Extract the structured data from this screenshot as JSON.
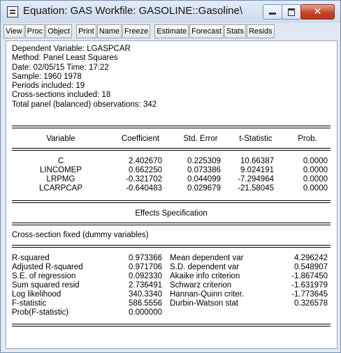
{
  "window": {
    "title": "Equation: GAS   Workfile: GASOLINE::Gasoline\\",
    "close_glyph": "✕"
  },
  "toolbar": [
    "View",
    "Proc",
    "Object",
    "Print",
    "Name",
    "Freeze",
    "Estimate",
    "Forecast",
    "Stats",
    "Resids"
  ],
  "header": [
    "Dependent Variable: LGASPCAR",
    "Method: Panel Least Squares",
    "Date: 02/05/15   Time: 17:22",
    "Sample: 1960 1978",
    "Periods included: 19",
    "Cross-sections included: 18",
    "Total panel (balanced) observations: 342"
  ],
  "coef_table": {
    "headers": [
      "Variable",
      "Coefficient",
      "Std. Error",
      "t-Statistic",
      "Prob."
    ],
    "rows": [
      [
        "C",
        "2.402670",
        "0.225309",
        "10.66387",
        "0.0000"
      ],
      [
        "LINCOMEP",
        "0.662250",
        "0.073386",
        "9.024191",
        "0.0000"
      ],
      [
        "LRPMG",
        "-0.321702",
        "0.044099",
        "-7.294964",
        "0.0000"
      ],
      [
        "LCARPCAP",
        "-0.640483",
        "0.029679",
        "-21.58045",
        "0.0000"
      ]
    ]
  },
  "effects": {
    "title": "Effects Specification",
    "spec": "Cross-section fixed (dummy variables)"
  },
  "stats": {
    "rows": [
      [
        "R-squared",
        "0.973366",
        "Mean dependent var",
        "4.296242"
      ],
      [
        "Adjusted R-squared",
        "0.971706",
        "S.D. dependent var",
        "0.548907"
      ],
      [
        "S.E. of regression",
        "0.092330",
        "Akaike info criterion",
        "-1.867450"
      ],
      [
        "Sum squared resid",
        "2.736491",
        "Schwarz criterion",
        "-1.631979"
      ],
      [
        "Log likelihood",
        "340.3340",
        "Hannan-Quinn criter.",
        "-1.773645"
      ],
      [
        "F-statistic",
        "586.5556",
        "Durbin-Watson stat",
        "0.326578"
      ],
      [
        "Prob(F-statistic)",
        "0.000000",
        "",
        ""
      ]
    ]
  }
}
